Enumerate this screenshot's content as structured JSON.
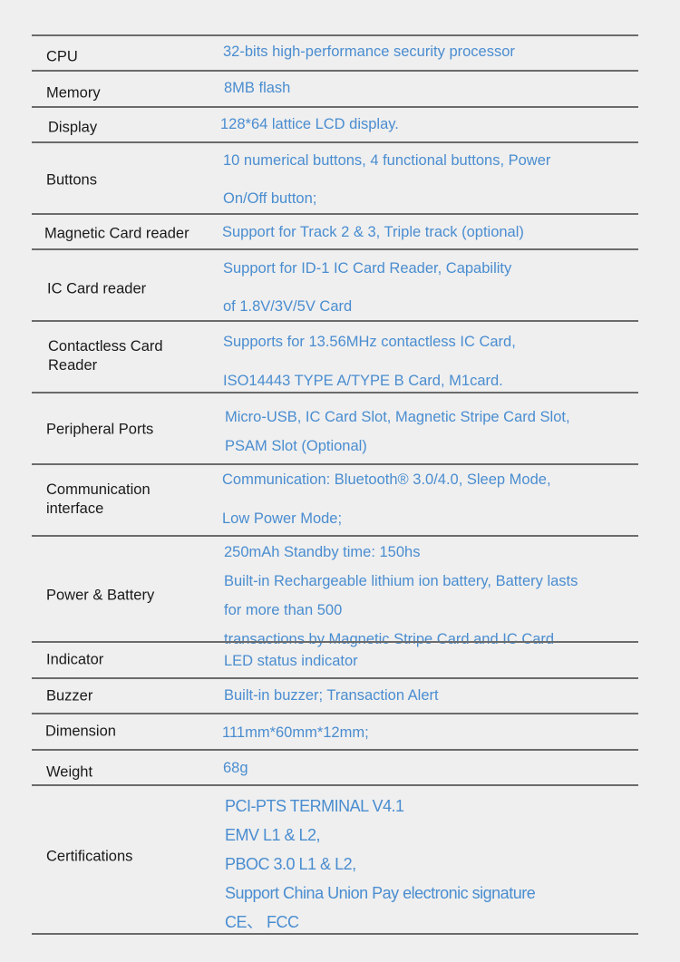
{
  "colors": {
    "label": "#1a1a1a",
    "value": "#4a8dd0",
    "rule": "#6b6b6b",
    "background": "#efefef"
  },
  "specs": [
    {
      "label": "CPU",
      "lines": [
        "32-bits high-performance security processor"
      ]
    },
    {
      "label": "Memory",
      "lines": [
        "8MB flash"
      ]
    },
    {
      "label": "Display",
      "lines": [
        "128*64 lattice LCD display."
      ]
    },
    {
      "label": "Buttons",
      "lines": [
        "10 numerical buttons, 4 functional buttons, Power",
        "On/Off button;"
      ]
    },
    {
      "label": "Magnetic Card reader",
      "lines": [
        "Support for Track 2 & 3, Triple track (optional)"
      ]
    },
    {
      "label": "IC Card reader",
      "lines": [
        "Support for ID-1 IC Card Reader, Capability",
        "of 1.8V/3V/5V Card"
      ]
    },
    {
      "label": "Contactless Card\nReader",
      "lines": [
        "Supports for 13.56MHz contactless IC Card,",
        "ISO14443 TYPE A/TYPE B Card, M1card."
      ]
    },
    {
      "label": "Peripheral Ports",
      "lines": [
        "Micro-USB, IC Card Slot, Magnetic Stripe Card Slot,",
        "PSAM Slot (Optional)"
      ]
    },
    {
      "label": "Communication\n interface",
      "lines": [
        "Communication: Bluetooth® 3.0/4.0, Sleep Mode,",
        "Low Power Mode;"
      ]
    },
    {
      "label": "Power & Battery",
      "lines": [
        "250mAh Standby time: 150hs",
        "Built-in Rechargeable lithium ion battery, Battery lasts",
        "for more than 500",
        "transactions by Magnetic Stripe Card and IC Card"
      ]
    },
    {
      "label": "Indicator",
      "lines": [
        "LED status indicator"
      ]
    },
    {
      "label": "Buzzer",
      "lines": [
        "Built-in buzzer; Transaction Alert"
      ]
    },
    {
      "label": "Dimension",
      "lines": [
        "111mm*60mm*12mm;"
      ]
    },
    {
      "label": "Weight",
      "lines": [
        "68g"
      ]
    },
    {
      "label": "Certifications",
      "lines": [
        "PCI-PTS TERMINAL V4.1",
        "EMV L1 & L2,",
        "PBOC 3.0 L1 & L2,",
        "Support China Union Pay electronic signature",
        "CE、 FCC"
      ]
    }
  ]
}
